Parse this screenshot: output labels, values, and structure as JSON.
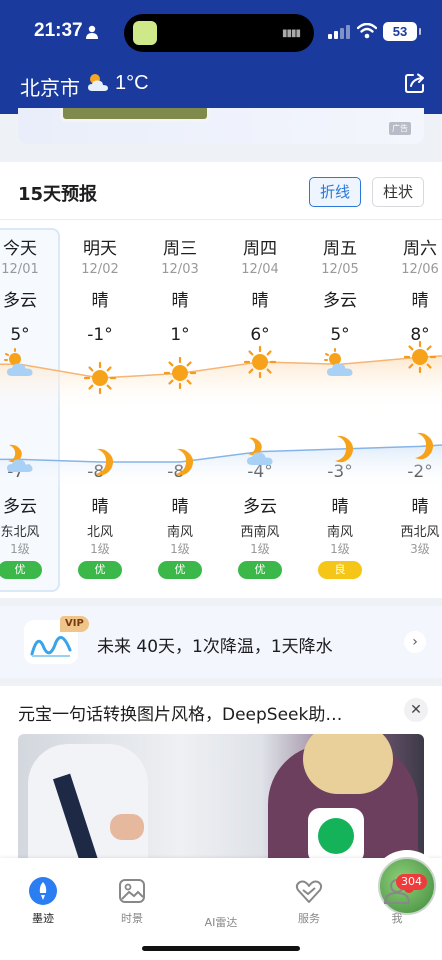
{
  "status_bar": {
    "time": "21:37",
    "battery": "53"
  },
  "header": {
    "city": "北京市",
    "current_temp": "1°C"
  },
  "ad": {
    "badge": "广告"
  },
  "forecast": {
    "title": "15天预报",
    "mode_buttons": {
      "line": "折线",
      "bar": "柱状"
    },
    "days": [
      {
        "name": "今天",
        "date": "12/01",
        "day_cond": "多云",
        "day_icon": "cloud-sun-icon",
        "high": "5°",
        "low": "-7°",
        "night_icon": "cloud-moon-icon",
        "night_cond": "多云",
        "wind": "东北风",
        "wind_level": "1级",
        "aqi": "优"
      },
      {
        "name": "明天",
        "date": "12/02",
        "day_cond": "晴",
        "day_icon": "sun-icon",
        "high": "-1°",
        "low": "-8°",
        "night_icon": "moon-icon",
        "night_cond": "晴",
        "wind": "北风",
        "wind_level": "1级",
        "aqi": "优"
      },
      {
        "name": "周三",
        "date": "12/03",
        "day_cond": "晴",
        "day_icon": "sun-icon",
        "high": "1°",
        "low": "-8°",
        "night_icon": "moon-icon",
        "night_cond": "晴",
        "wind": "南风",
        "wind_level": "1级",
        "aqi": "优"
      },
      {
        "name": "周四",
        "date": "12/04",
        "day_cond": "晴",
        "day_icon": "sun-icon",
        "high": "6°",
        "low": "-4°",
        "night_icon": "cloud-moon-icon",
        "night_cond": "多云",
        "wind": "西南风",
        "wind_level": "1级",
        "aqi": "优"
      },
      {
        "name": "周五",
        "date": "12/05",
        "day_cond": "多云",
        "day_icon": "cloud-sun-icon",
        "high": "5°",
        "low": "-3°",
        "night_icon": "moon-icon",
        "night_cond": "晴",
        "wind": "南风",
        "wind_level": "1级",
        "aqi": "良"
      },
      {
        "name": "周六",
        "date": "12/06",
        "day_cond": "晴",
        "day_icon": "sun-icon",
        "high": "8°",
        "low": "-2°",
        "night_icon": "moon-icon",
        "night_cond": "晴",
        "wind": "西北风",
        "wind_level": "3级",
        "aqi": ""
      }
    ],
    "aqi_colors": {
      "优": "#3cb84a",
      "良": "#f5c518"
    }
  },
  "trend": {
    "vip": "VIP",
    "text": "未来 40天，1次降温，1天降水"
  },
  "news": {
    "title": "元宝一句话转换图片风格，DeepSeek助…"
  },
  "tabbar": {
    "tabs": [
      {
        "label": "墨迹",
        "icon": "rocket-icon"
      },
      {
        "label": "时景",
        "icon": "image-icon"
      },
      {
        "label": "AI雷达",
        "icon": "radar-icon"
      },
      {
        "label": "服务",
        "icon": "heart-hands-icon"
      },
      {
        "label": "我",
        "icon": "user-icon"
      }
    ],
    "me_badge": "304"
  },
  "colors": {
    "header_bg": "#1a3a9e",
    "accent": "#2a78d8",
    "high_line": "#f7b472",
    "low_line": "#86b4e8"
  }
}
